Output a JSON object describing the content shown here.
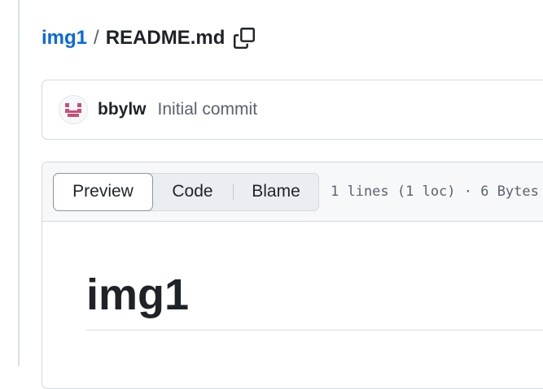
{
  "breadcrumb": {
    "repo": "img1",
    "separator": "/",
    "file": "README.md",
    "copy_icon": "copy-icon"
  },
  "commit": {
    "author": "bbylw",
    "message": "Initial commit",
    "avatar_icon": "identicon-avatar"
  },
  "file_view": {
    "tabs": [
      {
        "label": "Preview",
        "selected": true
      },
      {
        "label": "Code",
        "selected": false
      },
      {
        "label": "Blame",
        "selected": false
      }
    ],
    "meta": "1 lines (1 loc) · 6 Bytes"
  },
  "readme": {
    "heading": "img1"
  },
  "colors": {
    "link": "#0969da",
    "text": "#1f2328",
    "muted": "#59636e",
    "border": "#d1d9e0",
    "header_bg": "#f6f8fa",
    "avatar_accent": "#c94f78"
  }
}
